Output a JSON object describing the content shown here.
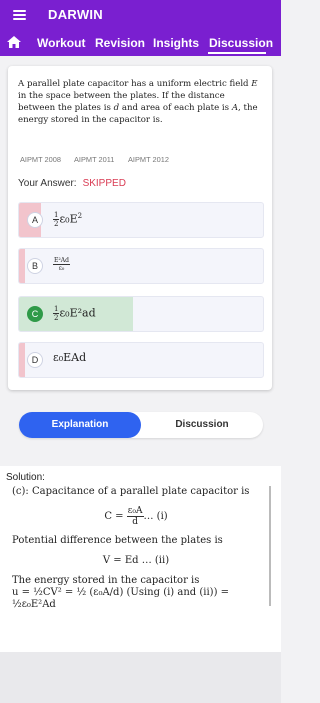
{
  "app": {
    "brand": "DARWIN",
    "nav": {
      "tabs": [
        {
          "label": "Workout"
        },
        {
          "label": "Revision"
        },
        {
          "label": "Insights"
        },
        {
          "label": "Discussion"
        }
      ]
    }
  },
  "question": {
    "text_prefix": "A parallel plate capacitor has a uniform electric field ",
    "field_symbol": "E",
    "text_mid1": " in the space between the plates. If the distance between the plates is ",
    "distance_symbol": "d",
    "text_mid2": " and area of each plate is ",
    "area_symbol": "A",
    "text_suffix": ", the energy stored in the capacitor is.",
    "tags": [
      "AIPMT 2008",
      "AIPMT 2011",
      "AIPMT 2012"
    ],
    "your_answer_label": "Your Answer:",
    "your_answer_status": "SKIPPED",
    "options": [
      {
        "letter": "A",
        "fraction_num": "1",
        "fraction_den": "2",
        "expr": "ε₀E",
        "sup": "2"
      },
      {
        "letter": "B",
        "fraction_num": "E²Ad",
        "fraction_den": "ε₀",
        "expr": "",
        "sup": ""
      },
      {
        "letter": "C",
        "fraction_num": "1",
        "fraction_den": "2",
        "expr": "ε₀E²ad",
        "sup": ""
      },
      {
        "letter": "D",
        "fraction_num": "",
        "fraction_den": "",
        "expr": "ε₀EAd",
        "sup": ""
      }
    ]
  },
  "segments": {
    "explanation": "Explanation",
    "discussion": "Discussion"
  },
  "solution": {
    "label": "Solution:",
    "line1": "(c): Capacitance of a parallel plate capacitor is",
    "eq1_lhs": "C =",
    "eq1_num": "ε₀A",
    "eq1_den": "d",
    "eq1_tail": "… (i)",
    "line2": "Potential difference between the plates is",
    "eq2": "V = Ed … (ii)",
    "line3": "The energy stored in the capacitor is",
    "line4": "u = ½CV² = ½ (ε₀A/d) (Using (i) and (ii)) =",
    "line5": "½ε₀E²Ad"
  },
  "colors": {
    "brand_purple": "#7a1fd0",
    "active_blue": "#2f63f0",
    "correct_green": "#2f9a48",
    "skipped_red": "#d93b53"
  }
}
